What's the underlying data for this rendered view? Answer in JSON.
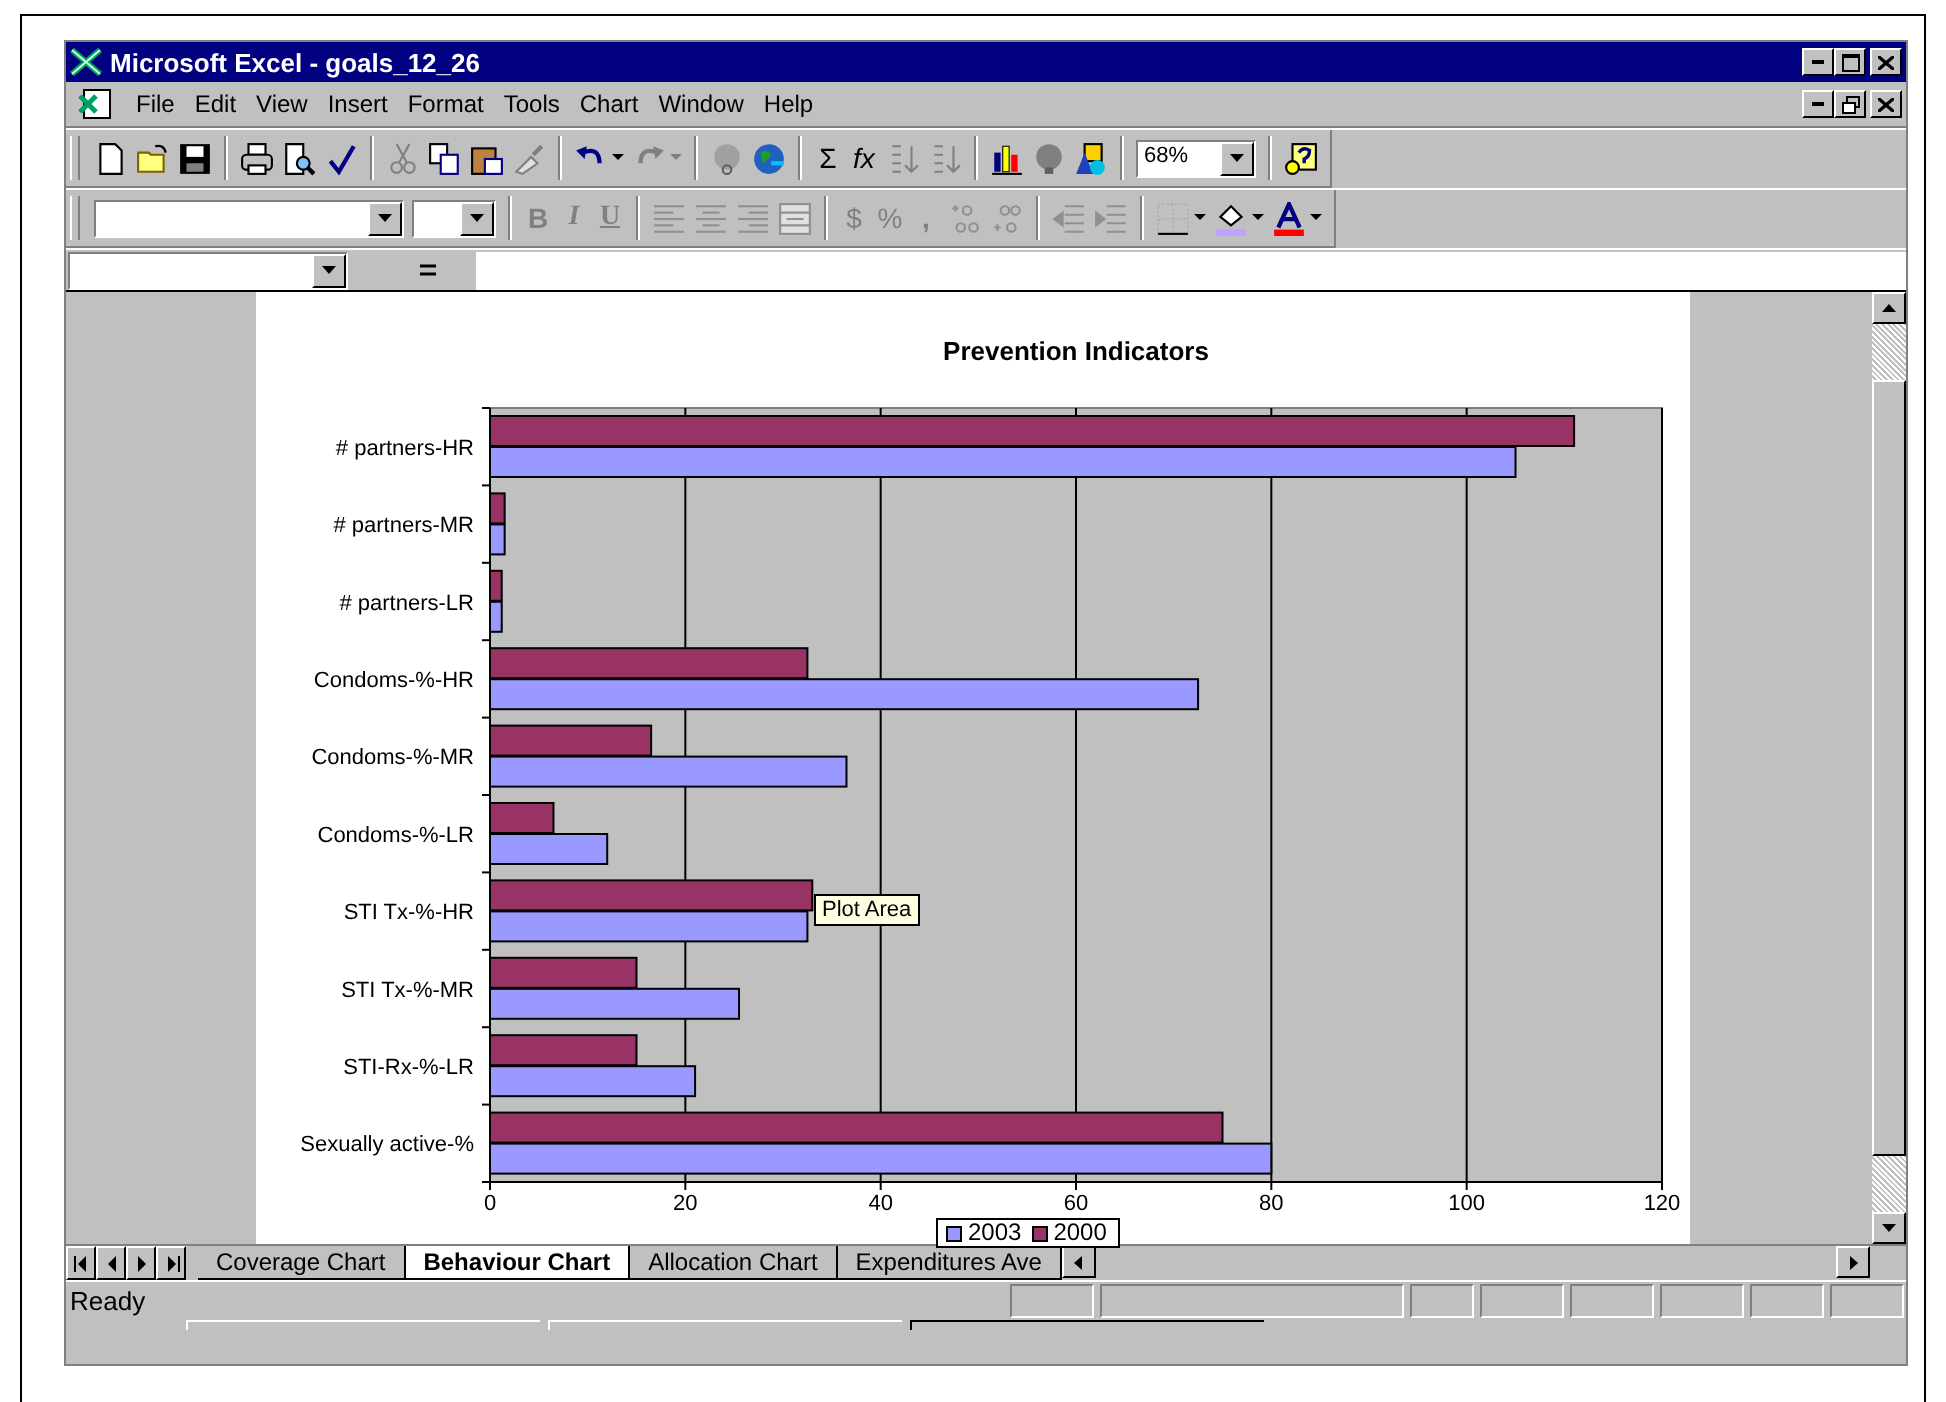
{
  "window": {
    "title": "Microsoft Excel - goals_12_26"
  },
  "menu": [
    "File",
    "Edit",
    "View",
    "Insert",
    "Format",
    "Tools",
    "Chart",
    "Window",
    "Help"
  ],
  "toolbar": {
    "sum": "Σ",
    "function": "fx",
    "zoom": "68%"
  },
  "format_toolbar": {
    "bold": "B",
    "italic": "I",
    "underline": "U",
    "currency": "$",
    "percent": "%",
    "comma": ","
  },
  "chart": {
    "chart_data": {
      "type": "bar",
      "orientation": "horizontal",
      "title": "Prevention Indicators",
      "categories": [
        "# partners-HR",
        "# partners-MR",
        "# partners-LR",
        "Condoms-%-HR",
        "Condoms-%-MR",
        "Condoms-%-LR",
        "STI Tx-%-HR",
        "STI Tx-%-MR",
        "STI-Rx-%-LR",
        "Sexually active-%"
      ],
      "series": [
        {
          "name": "2003",
          "color": "#9999ff",
          "values": [
            105,
            1.5,
            1.2,
            72.5,
            36.5,
            12,
            32.5,
            25.5,
            21,
            80
          ]
        },
        {
          "name": "2000",
          "color": "#993366",
          "values": [
            111,
            1.5,
            1.2,
            32.5,
            16.5,
            6.5,
            33,
            15,
            15,
            75
          ]
        }
      ],
      "xlim": [
        0,
        120
      ],
      "xticks": [
        0,
        20,
        40,
        60,
        80,
        100,
        120
      ],
      "grid": true,
      "legend": true
    },
    "tooltip": "Plot Area"
  },
  "sheet_tabs": [
    {
      "label": "Coverage Chart",
      "selected": false
    },
    {
      "label": "Behaviour Chart",
      "selected": true
    },
    {
      "label": "Allocation Chart",
      "selected": false
    },
    {
      "label": "Expenditures Ave",
      "selected": false
    }
  ],
  "status_bar": {
    "text": "Ready"
  }
}
